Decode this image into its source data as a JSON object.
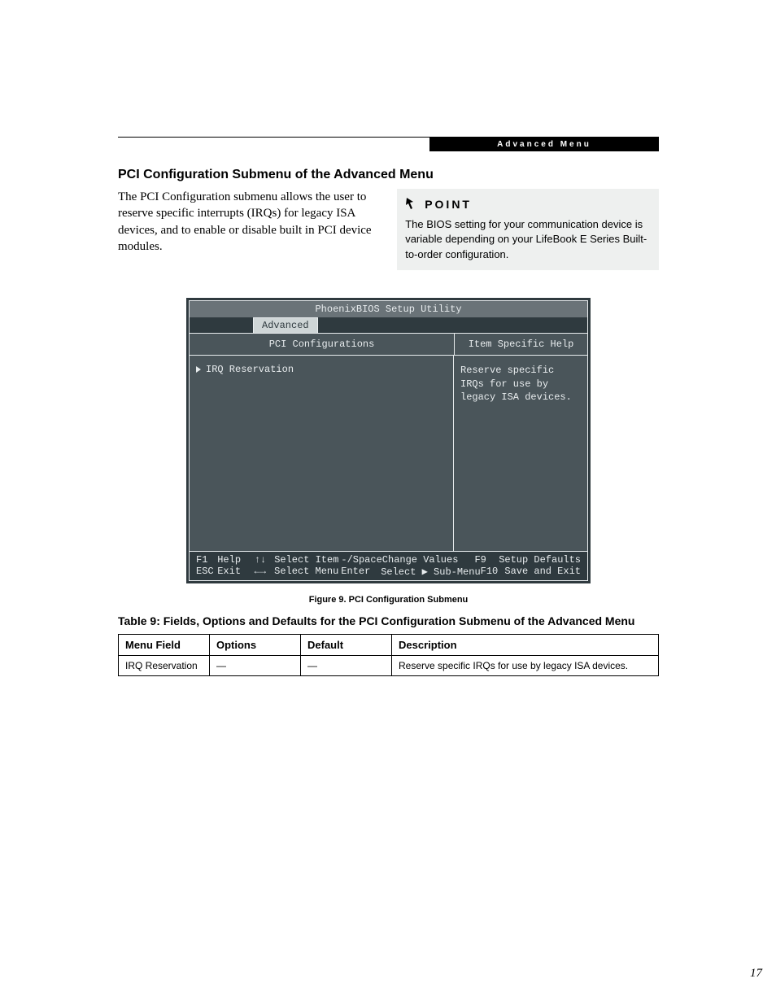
{
  "header_strip": "Advanced Menu",
  "heading": "PCI Configuration Submenu of the Advanced Menu",
  "intro": "The PCI Configuration submenu allows the user to reserve specific interrupts (IRQs) for legacy ISA devices, and to enable or disable built in PCI device modules.",
  "point": {
    "label": "POINT",
    "text": "The BIOS setting for your communication device is variable depending on your LifeBook E Series Built-to-order configuration."
  },
  "bios": {
    "title": "PhoenixBIOS Setup Utility",
    "tab": "Advanced",
    "left_header": "PCI Configurations",
    "right_header": "Item Specific Help",
    "item": "IRQ Reservation",
    "help": "Reserve specific IRQs for use by legacy ISA devices.",
    "foot": {
      "r1": {
        "k1": "F1",
        "l1": "Help",
        "a1": "↑↓",
        "s1": "Select Item",
        "k2": "-/Space",
        "v1": "Change Values",
        "k3": "F9",
        "l3": "Setup Defaults"
      },
      "r2": {
        "k1": "ESC",
        "l1": "Exit",
        "a1": "←→",
        "s1": "Select Menu",
        "k2": "Enter",
        "v1": "Select ▶ Sub-Menu",
        "k3": "F10",
        "l3": "Save and Exit"
      }
    }
  },
  "fig_caption": "Figure 9.  PCI Configuration Submenu",
  "table_caption": "Table 9: Fields, Options and Defaults for the PCI Configuration Submenu of the Advanced Menu",
  "table": {
    "headers": {
      "c1": "Menu Field",
      "c2": "Options",
      "c3": "Default",
      "c4": "Description"
    },
    "row": {
      "c1": "IRQ Reservation",
      "c2": "—",
      "c3": "—",
      "c4": "Reserve specific IRQs for use by legacy ISA devices."
    }
  },
  "page_number": "17"
}
